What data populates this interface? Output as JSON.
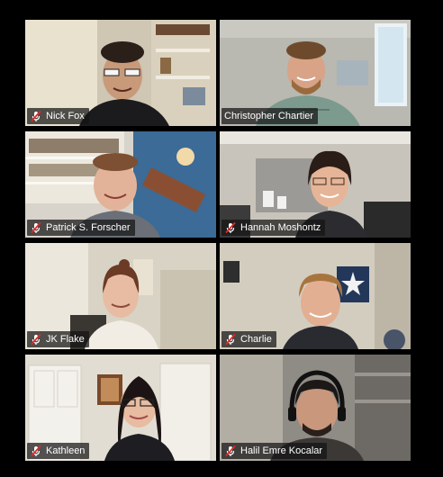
{
  "participants": [
    {
      "name": "Nick Fox",
      "muted": true,
      "active_speaker": false
    },
    {
      "name": "Christopher Chartier",
      "muted": false,
      "active_speaker": true
    },
    {
      "name": "Patrick S. Forscher",
      "muted": true,
      "active_speaker": false
    },
    {
      "name": "Hannah Moshontz",
      "muted": true,
      "active_speaker": false
    },
    {
      "name": "JK Flake",
      "muted": true,
      "active_speaker": false
    },
    {
      "name": "Charlie",
      "muted": true,
      "active_speaker": false
    },
    {
      "name": "Kathleen",
      "muted": true,
      "active_speaker": false
    },
    {
      "name": "Halil Emre Kocalar",
      "muted": true,
      "active_speaker": false
    }
  ],
  "colors": {
    "background": "#000000",
    "active_border": "#c9dc6b",
    "mute_red": "#e02828",
    "name_text": "#ffffff"
  },
  "icons": {
    "mute": "microphone-muted-icon"
  }
}
